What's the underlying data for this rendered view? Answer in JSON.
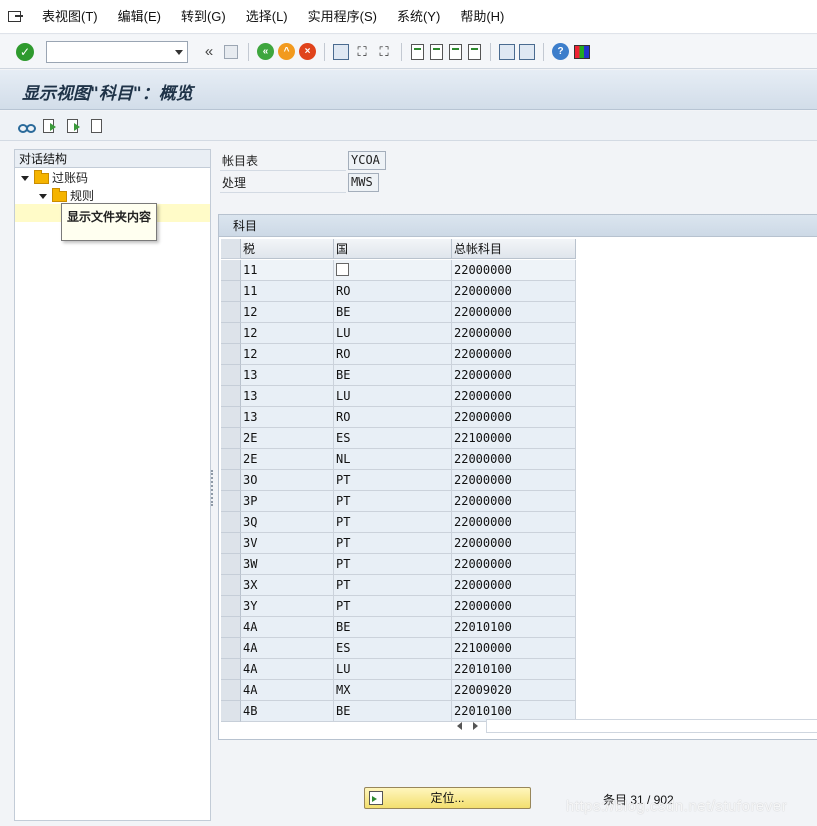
{
  "menu": {
    "items": [
      "表视图(T)",
      "编辑(E)",
      "转到(G)",
      "选择(L)",
      "实用程序(S)",
      "系统(Y)",
      "帮助(H)"
    ]
  },
  "toolbar": {
    "command_value": "",
    "double_left": "«"
  },
  "title": "显示视图\"科目\"：概览",
  "tree": {
    "header": "对话结构",
    "node1": "过账码",
    "node2": "规则",
    "tooltip": "显示文件夹内容"
  },
  "header_fields": [
    {
      "label": "帐目表",
      "value": "YCOA"
    },
    {
      "label": "处理",
      "value": "MWS"
    }
  ],
  "table": {
    "title": "科目",
    "columns": [
      "税",
      "国",
      "总帐科目"
    ],
    "rows": [
      [
        "11",
        "",
        "22000000"
      ],
      [
        "11",
        "RO",
        "22000000"
      ],
      [
        "12",
        "BE",
        "22000000"
      ],
      [
        "12",
        "LU",
        "22000000"
      ],
      [
        "12",
        "RO",
        "22000000"
      ],
      [
        "13",
        "BE",
        "22000000"
      ],
      [
        "13",
        "LU",
        "22000000"
      ],
      [
        "13",
        "RO",
        "22000000"
      ],
      [
        "2E",
        "ES",
        "22100000"
      ],
      [
        "2E",
        "NL",
        "22000000"
      ],
      [
        "3O",
        "PT",
        "22000000"
      ],
      [
        "3P",
        "PT",
        "22000000"
      ],
      [
        "3Q",
        "PT",
        "22000000"
      ],
      [
        "3V",
        "PT",
        "22000000"
      ],
      [
        "3W",
        "PT",
        "22000000"
      ],
      [
        "3X",
        "PT",
        "22000000"
      ],
      [
        "3Y",
        "PT",
        "22000000"
      ],
      [
        "4A",
        "BE",
        "22010100"
      ],
      [
        "4A",
        "ES",
        "22100000"
      ],
      [
        "4A",
        "LU",
        "22010100"
      ],
      [
        "4A",
        "MX",
        "22009020"
      ],
      [
        "4B",
        "BE",
        "22010100"
      ]
    ]
  },
  "bottom": {
    "position_button": "定位...",
    "entry_info": "条目 31 / 902",
    "watermark": "https://blog.csdn.net/stuforever"
  }
}
